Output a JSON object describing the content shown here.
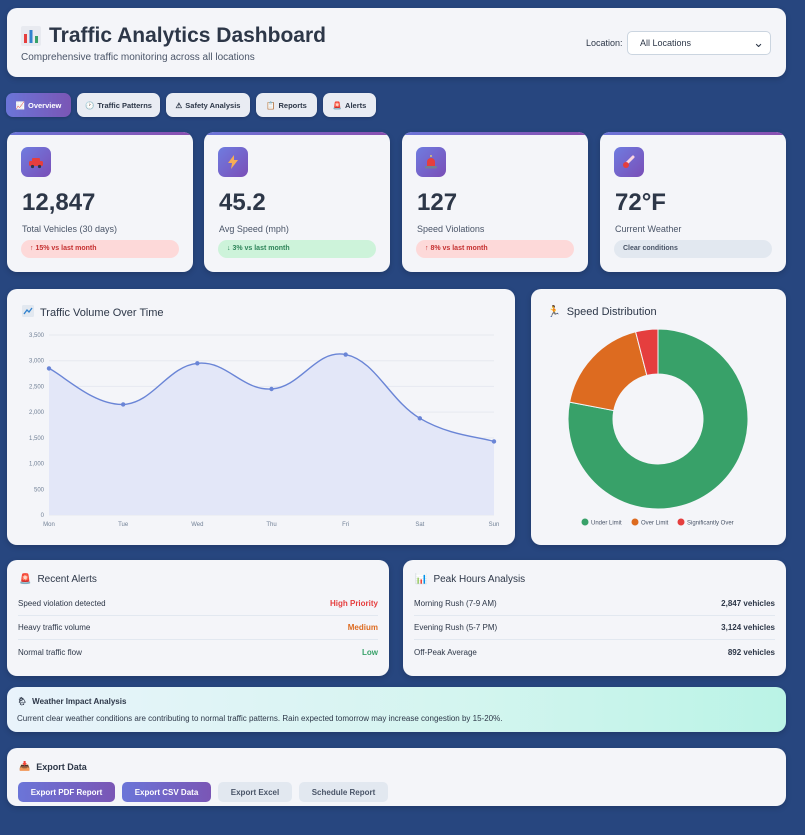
{
  "header": {
    "title": "Traffic Analytics Dashboard",
    "subtitle": "Comprehensive traffic monitoring across all locations",
    "location_label": "Location:",
    "location_value": "All Locations"
  },
  "tabs": [
    {
      "label": "Overview",
      "icon": "chart-icon",
      "active": true
    },
    {
      "label": "Traffic Patterns",
      "icon": "clock-icon"
    },
    {
      "label": "Safety Analysis",
      "icon": "warning-icon"
    },
    {
      "label": "Reports",
      "icon": "clipboard-icon"
    },
    {
      "label": "Alerts",
      "icon": "siren-icon"
    }
  ],
  "stats": [
    {
      "value": "12,847",
      "label": "Total Vehicles (30 days)",
      "change": "↑ 15% vs last month",
      "icon": "car-icon"
    },
    {
      "value": "45.2",
      "label": "Avg Speed (mph)",
      "change": "↓ 3% vs last month",
      "icon": "lightning-icon"
    },
    {
      "value": "127",
      "label": "Speed Violations",
      "change": "↑ 8% vs last month",
      "icon": "siren-icon"
    },
    {
      "value": "72°F",
      "label": "Current Weather",
      "change": "Clear conditions",
      "icon": "thermometer-icon"
    }
  ],
  "chart_data": [
    {
      "type": "area",
      "title": "Traffic Volume Over Time",
      "categories": [
        "Mon",
        "Tue",
        "Wed",
        "Thu",
        "Fri",
        "Sat",
        "Sun"
      ],
      "values": [
        2850,
        2150,
        2950,
        2450,
        3120,
        1880,
        1430
      ],
      "ylim": [
        0,
        3500
      ],
      "yticks": [
        "3,500",
        "3,000",
        "2,500",
        "2,000",
        "1,500",
        "1,000",
        "500",
        "0"
      ],
      "grid": true,
      "color": "#6a85d6"
    },
    {
      "type": "pie",
      "title": "Speed Distribution",
      "labels": [
        "Under Limit",
        "Over Limit",
        "Significantly Over"
      ],
      "values": [
        78,
        18,
        4
      ],
      "colors": [
        "#38a169",
        "#dd6b20",
        "#e53e3e"
      ],
      "legend": "bottom"
    }
  ],
  "alerts": {
    "title": "Recent Alerts",
    "rows": [
      {
        "label": "Speed violation detected",
        "value": "High Priority",
        "color": "#e53e3e"
      },
      {
        "label": "Heavy traffic volume",
        "value": "Medium",
        "color": "#dd6b20"
      },
      {
        "label": "Normal traffic flow",
        "value": "Low",
        "color": "#38a169"
      }
    ]
  },
  "peak": {
    "title": "Peak Hours Analysis",
    "rows": [
      {
        "label": "Morning Rush (7-9 AM)",
        "value": "2,847 vehicles"
      },
      {
        "label": "Evening Rush (5-7 PM)",
        "value": "3,124 vehicles"
      },
      {
        "label": "Off-Peak Average",
        "value": "892 vehicles"
      }
    ]
  },
  "weather": {
    "title": "Weather Impact Analysis",
    "description": "Current clear weather conditions are contributing to normal traffic patterns. Rain expected tomorrow may increase congestion by 15-20%."
  },
  "export": {
    "title": "Export Data",
    "buttons": [
      "Export PDF Report",
      "Export CSV Data",
      "Export Excel",
      "Schedule Report"
    ]
  }
}
